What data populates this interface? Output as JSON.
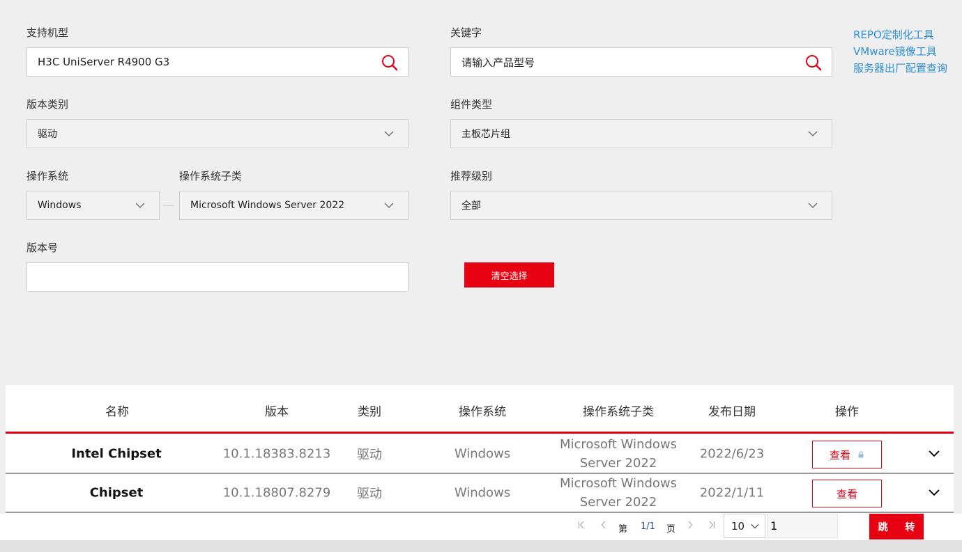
{
  "filters": {
    "model_label": "支持机型",
    "model_value": "H3C UniServer R4900 G3",
    "keyword_label": "关键字",
    "keyword_placeholder": "请输入产品型号",
    "version_type_label": "版本类别",
    "version_type_value": "驱动",
    "component_type_label": "组件类型",
    "component_type_value": "主板芯片组",
    "os_label": "操作系统",
    "os_value": "Windows",
    "os_sub_label": "操作系统子类",
    "os_sub_value": "Microsoft Windows Server 2022",
    "recommend_label": "推荐级别",
    "recommend_value": "全部",
    "version_no_label": "版本号",
    "version_no_value": "",
    "clear_button": "清空选择"
  },
  "side_links": [
    "REPO定制化工具",
    "VMware镜像工具",
    "服务器出厂配置查询"
  ],
  "table": {
    "headers": [
      "名称",
      "版本",
      "类别",
      "操作系统",
      "操作系统子类",
      "发布日期",
      "操作"
    ],
    "rows": [
      {
        "name": "Intel Chipset",
        "version": "10.1.18383.8213",
        "category": "驱动",
        "os": "Windows",
        "os_sub": "Microsoft Windows Server 2022",
        "date": "2022/6/23",
        "action": "查看",
        "locked": true
      },
      {
        "name": "Chipset",
        "version": "10.1.18807.8279",
        "category": "驱动",
        "os": "Windows",
        "os_sub": "Microsoft Windows Server 2022",
        "date": "2022/1/11",
        "action": "查看",
        "locked": false
      }
    ]
  },
  "pagination": {
    "page_prefix": "第",
    "page_indicator": "1/1",
    "page_suffix": "页",
    "page_size": "10",
    "jump_value": "1",
    "jump_button": "跳 转"
  },
  "colors": {
    "accent": "#e60012",
    "link": "#2e8fd4"
  },
  "icons": [
    "search-icon",
    "chevron-down-icon",
    "lock-icon",
    "first-page-icon",
    "prev-page-icon",
    "next-page-icon",
    "last-page-icon"
  ]
}
